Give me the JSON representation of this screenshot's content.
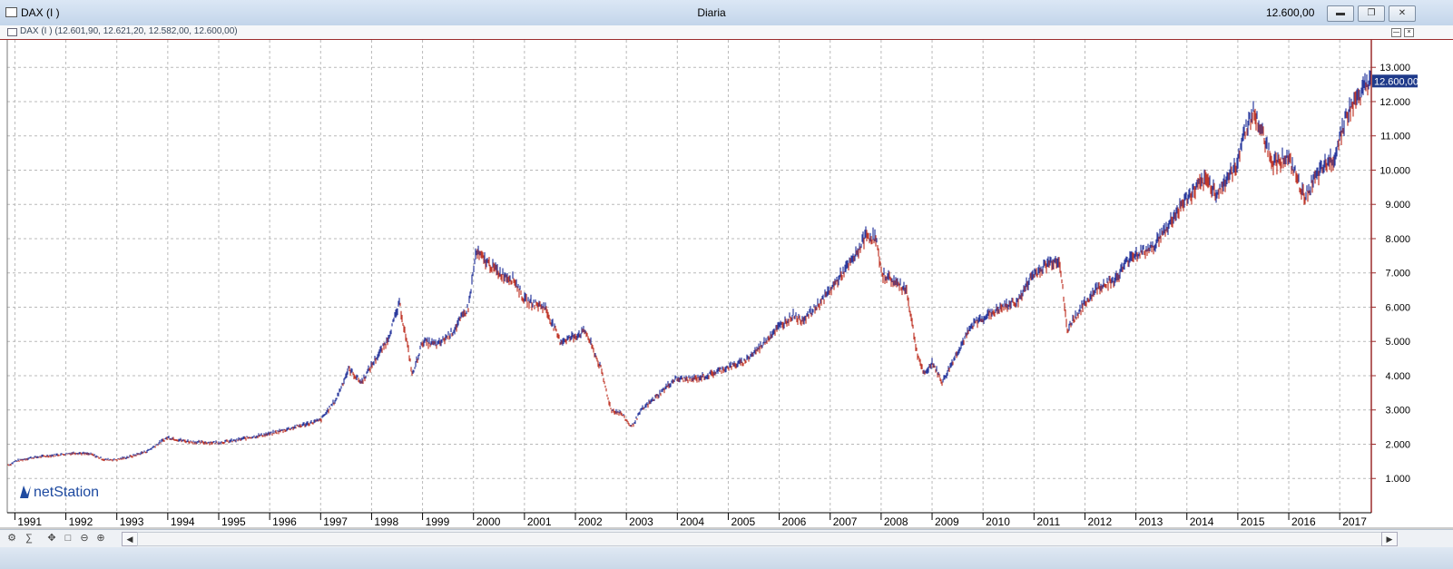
{
  "window": {
    "title": "DAX (I )",
    "period": "Diaria",
    "last_price": "12.600,00",
    "min_icon": "minimize-icon",
    "restore_icon": "restore-icon",
    "close_icon": "close-icon"
  },
  "infobar": {
    "text": "DAX (I ) (12.601,90, 12.621,20, 12.582,00, 12.600,00)"
  },
  "watermark": {
    "text": "netStation"
  },
  "toolbar_icons": [
    "chart-settings-icon",
    "scale-icon",
    "pan-icon",
    "zoom-fit-icon",
    "zoom-out-icon",
    "zoom-in-icon"
  ],
  "colors": {
    "up": "#2b3a9e",
    "down": "#c0392b",
    "frame": "#9b2c2c",
    "grid": "#b9b9b9",
    "price_tag": "#1f3a8a"
  },
  "chart_data": {
    "type": "line",
    "title": "DAX (I )",
    "style": "ohlc-bars",
    "x_unit": "year",
    "xlim": [
      1990.85,
      2017.62
    ],
    "ylim": [
      0,
      13800
    ],
    "y_ticks": [
      1000,
      2000,
      3000,
      4000,
      5000,
      6000,
      7000,
      8000,
      9000,
      10000,
      11000,
      12000,
      13000
    ],
    "y_tick_labels": [
      "1.000",
      "2.000",
      "3.000",
      "4.000",
      "5.000",
      "6.000",
      "7.000",
      "8.000",
      "9.000",
      "10.000",
      "11.000",
      "12.000",
      "13.000"
    ],
    "x_tick_labels": [
      "1991",
      "1992",
      "1993",
      "1994",
      "1995",
      "1996",
      "1997",
      "1998",
      "1999",
      "2000",
      "2001",
      "2002",
      "2003",
      "2004",
      "2005",
      "2006",
      "2007",
      "2008",
      "2009",
      "2010",
      "2011",
      "2012",
      "2013",
      "2014",
      "2015",
      "2016",
      "2017"
    ],
    "grid": true,
    "last_value_label": "12.600,00",
    "series": [
      {
        "x": [
          1990.9,
          1991.0,
          1991.3,
          1991.6,
          1991.9,
          1992.2,
          1992.5,
          1992.75,
          1993.0,
          1993.3,
          1993.6,
          1993.9,
          1994.0,
          1994.3,
          1994.6,
          1995.0,
          1995.3,
          1995.6,
          1996.0,
          1996.5,
          1997.0,
          1997.3,
          1997.55,
          1997.8,
          1998.0,
          1998.3,
          1998.55,
          1998.75,
          1998.8,
          1999.0,
          1999.3,
          1999.6,
          1999.9,
          2000.05,
          2000.2,
          2000.5,
          2000.8,
          2001.0,
          2001.4,
          2001.7,
          2001.9,
          2002.2,
          2002.5,
          2002.7,
          2002.9,
          2003.1,
          2003.3,
          2003.6,
          2003.95,
          2004.3,
          2004.6,
          2004.9,
          2005.3,
          2005.6,
          2005.9,
          2006.3,
          2006.4,
          2006.6,
          2006.9,
          2007.2,
          2007.5,
          2007.7,
          2007.9,
          2008.0,
          2008.2,
          2008.5,
          2008.7,
          2008.85,
          2009.0,
          2009.2,
          2009.5,
          2009.8,
          2010.0,
          2010.4,
          2010.7,
          2010.95,
          2011.3,
          2011.5,
          2011.65,
          2011.75,
          2011.9,
          2012.2,
          2012.4,
          2012.6,
          2012.9,
          2013.3,
          2013.6,
          2013.9,
          2014.2,
          2014.4,
          2014.6,
          2014.8,
          2014.95,
          2015.1,
          2015.3,
          2015.5,
          2015.7,
          2015.95,
          2016.1,
          2016.3,
          2016.45,
          2016.7,
          2016.9,
          2017.1,
          2017.3,
          2017.45,
          2017.55,
          2017.62
        ],
        "y": [
          1400,
          1500,
          1600,
          1650,
          1700,
          1750,
          1700,
          1550,
          1550,
          1650,
          1800,
          2100,
          2200,
          2100,
          2050,
          2050,
          2100,
          2200,
          2300,
          2500,
          2700,
          3300,
          4200,
          3800,
          4300,
          5000,
          6100,
          4500,
          4000,
          5000,
          4900,
          5300,
          6000,
          7600,
          7400,
          7000,
          6800,
          6200,
          6000,
          5000,
          5100,
          5300,
          4200,
          3000,
          2900,
          2500,
          3000,
          3400,
          3900,
          3900,
          4000,
          4200,
          4400,
          4800,
          5300,
          5800,
          5600,
          5800,
          6300,
          6900,
          7500,
          8100,
          8000,
          7000,
          6800,
          6500,
          4700,
          4000,
          4400,
          3800,
          4700,
          5500,
          5700,
          6000,
          6200,
          6900,
          7300,
          7400,
          5300,
          5600,
          5900,
          6500,
          6700,
          6800,
          7500,
          7700,
          8300,
          9000,
          9500,
          9700,
          9300,
          9800,
          10000,
          11000,
          11700,
          11000,
          10200,
          10400,
          10000,
          9200,
          9600,
          10100,
          10400,
          11500,
          12000,
          12300,
          12500,
          12600
        ]
      }
    ]
  }
}
